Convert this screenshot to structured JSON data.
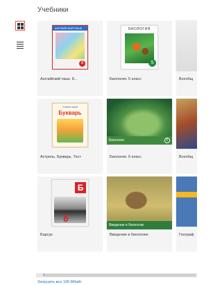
{
  "page": {
    "title": "Учебники"
  },
  "view_toggles": {
    "grid_icon": "grid-view-icon",
    "list_icon": "list-view-icon",
    "active_color": "#e3543b"
  },
  "books": [
    {
      "caption": "Английский язык. 8...",
      "cover": {
        "band_text": "АНГЛИЙСКИЙ ЯЗЫК",
        "badge": "8"
      }
    },
    {
      "caption": "Биология. 5 класс",
      "cover": {
        "title_text": "БИОЛОГИЯ",
        "badge": "5"
      }
    },
    {
      "caption": "Всеобщ"
    },
    {
      "caption": "Астрель. Букварь. Тест",
      "cover": {
        "top_text": "Учимся играя",
        "title_text": "Букварь"
      }
    },
    {
      "caption": "Биология. 6 класс",
      "cover": {
        "strip_text": "Биология",
        "badge": "6"
      }
    },
    {
      "caption": "Всеобщ"
    },
    {
      "caption": "Барсук",
      "cover": {
        "flag_text": "Б",
        "grade_text": "6"
      }
    },
    {
      "caption": "Введение в биологию",
      "cover": {
        "strip_text": "Введение в биологию"
      }
    },
    {
      "caption": "Географ"
    }
  ],
  "scroll": {
    "left_arrow": "‹"
  },
  "footer": {
    "download_all": "Загрузить все 100 Мбайт"
  }
}
